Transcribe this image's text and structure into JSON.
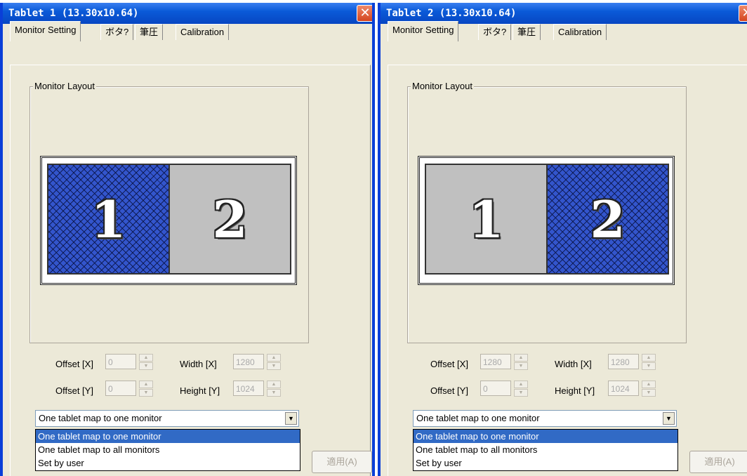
{
  "windows": [
    {
      "title": "Tablet  1 (13.30x10.64)",
      "close_glyph": "✕",
      "tabs": [
        "Monitor Setting",
        "ボタ?",
        "筆圧",
        "Calibration"
      ],
      "active_tab": "Monitor Setting",
      "group_label": "Monitor Layout",
      "monitors": [
        {
          "label": "1",
          "selected": true
        },
        {
          "label": "2",
          "selected": false
        }
      ],
      "fields": {
        "offset_x_label": "Offset [X]",
        "offset_x_value": "0",
        "offset_y_label": "Offset [Y]",
        "offset_y_value": "0",
        "width_label": "Width [X]",
        "width_value": "1280",
        "height_label": "Height [Y]",
        "height_value": "1024"
      },
      "mapping_select": {
        "selected": "One tablet map to one monitor",
        "options": [
          "One tablet map to one monitor",
          "One tablet map to all monitors",
          "Set by user"
        ]
      },
      "apply_label": "適用(A)"
    },
    {
      "title": "Tablet  2 (13.30x10.64)",
      "close_glyph": "✕",
      "tabs": [
        "Monitor Setting",
        "ボタ?",
        "筆圧",
        "Calibration"
      ],
      "active_tab": "Monitor Setting",
      "group_label": "Monitor Layout",
      "monitors": [
        {
          "label": "1",
          "selected": false
        },
        {
          "label": "2",
          "selected": true
        }
      ],
      "fields": {
        "offset_x_label": "Offset [X]",
        "offset_x_value": "1280",
        "offset_y_label": "Offset [Y]",
        "offset_y_value": "0",
        "width_label": "Width [X]",
        "width_value": "1280",
        "height_label": "Height [Y]",
        "height_value": "1024"
      },
      "mapping_select": {
        "selected": "One tablet map to one monitor",
        "options": [
          "One tablet map to one monitor",
          "One tablet map to all monitors",
          "Set by user"
        ]
      },
      "apply_label": "適用(A)"
    }
  ],
  "colors": {
    "titlebar": "#0a5ad8",
    "selected_monitor": "#3355cc",
    "unselected_monitor": "#c0c0c0",
    "highlight": "#316ac5",
    "dialog_bg": "#ece9d8"
  },
  "icons": {
    "close": "close-icon",
    "spin_up": "spin-up-arrow-icon",
    "spin_down": "spin-down-arrow-icon",
    "dropdown": "chevron-down-icon"
  }
}
